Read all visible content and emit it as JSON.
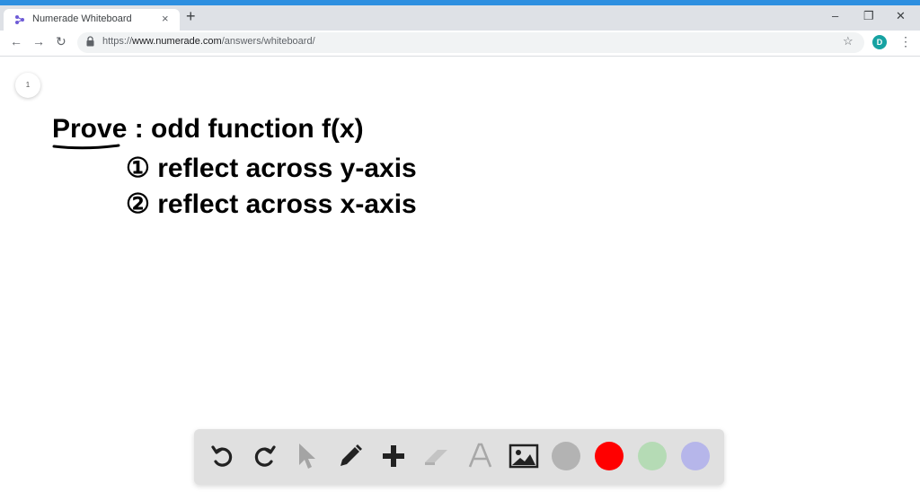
{
  "browser": {
    "tab_title": "Numerade Whiteboard",
    "tab_close": "×",
    "new_tab": "+",
    "url_scheme": "https://",
    "url_host": "www.numerade.com",
    "url_path": "/answers/whiteboard/",
    "profile_initial": "D",
    "window_controls": {
      "minimize": "–",
      "restore": "❐",
      "close": "✕"
    }
  },
  "whiteboard": {
    "page_number": "1",
    "ink_color": "#000000",
    "lines": [
      "Prove :  odd function f(x)",
      "① reflect across y-axis",
      "② reflect across x-axis"
    ]
  },
  "dock": {
    "tools": [
      "undo-icon",
      "redo-icon",
      "select-icon",
      "pencil-icon",
      "add-icon",
      "eraser-icon",
      "text-icon",
      "image-icon"
    ],
    "swatches": [
      "#b3b3b3",
      "#ff0000",
      "#b5dbb5",
      "#b6b6ea"
    ]
  }
}
